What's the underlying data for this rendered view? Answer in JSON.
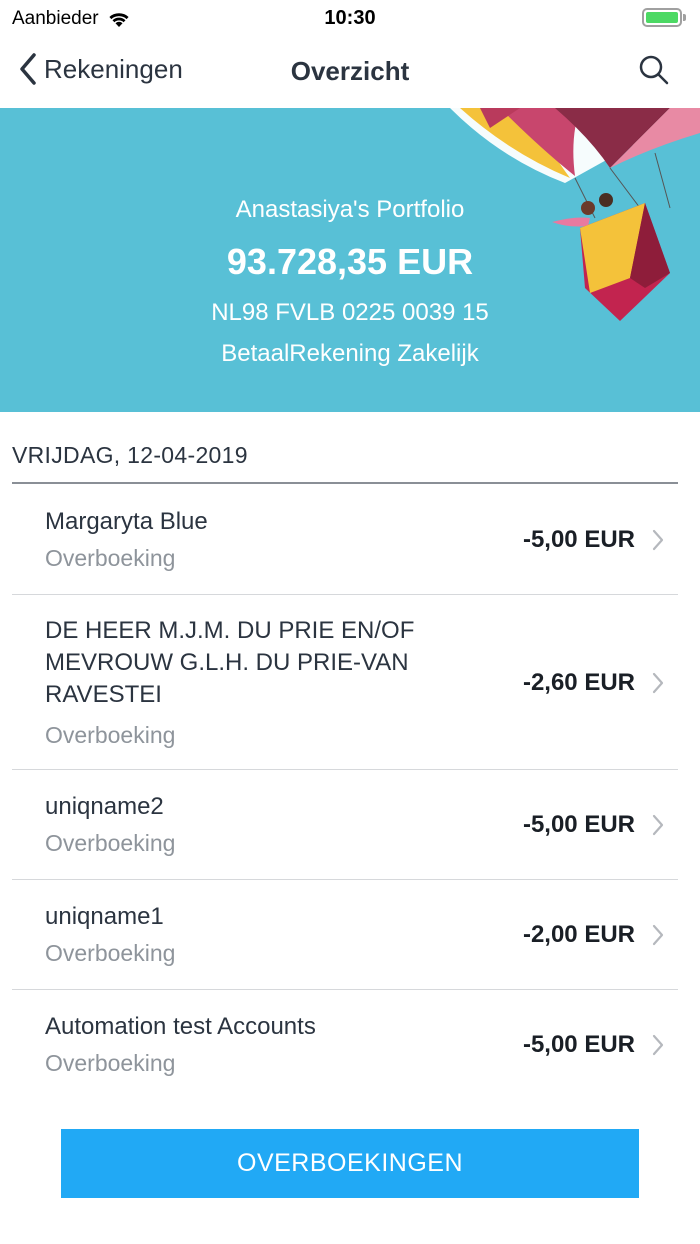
{
  "status_bar": {
    "carrier": "Aanbieder",
    "time": "10:30",
    "battery_level": 1.0,
    "battery_color": "#4cd964"
  },
  "nav": {
    "back_label": "Rekeningen",
    "title": "Overzicht",
    "back_icon": "chevron-left-icon",
    "search_icon": "search-icon"
  },
  "account": {
    "portfolio_name": "Anastasiya's Portfolio",
    "balance": "93.728,35 EUR",
    "iban": "NL98 FVLB 0225 0039 15",
    "type": "BetaalRekening Zakelijk",
    "header_color": "#58c0d6"
  },
  "date_group": "VRIJDAG, 12-04-2019",
  "transactions": [
    {
      "name": "Margaryta Blue",
      "type": "Overboeking",
      "amount": "-5,00 EUR"
    },
    {
      "name": "DE HEER M.J.M. DU PRIE EN/OF\nMEVROUW G.L.H. DU PRIE-VAN\nRAVESTEI",
      "type": "Overboeking",
      "amount": "-2,60 EUR"
    },
    {
      "name": "uniqname2",
      "type": "Overboeking",
      "amount": "-5,00 EUR"
    },
    {
      "name": "uniqname1",
      "type": "Overboeking",
      "amount": "-2,00 EUR"
    },
    {
      "name": "Automation test Accounts",
      "type": "Overboeking",
      "amount": "-5,00 EUR"
    }
  ],
  "primary_button": {
    "label": "OVERBOEKINGEN",
    "color": "#21a9f5"
  }
}
